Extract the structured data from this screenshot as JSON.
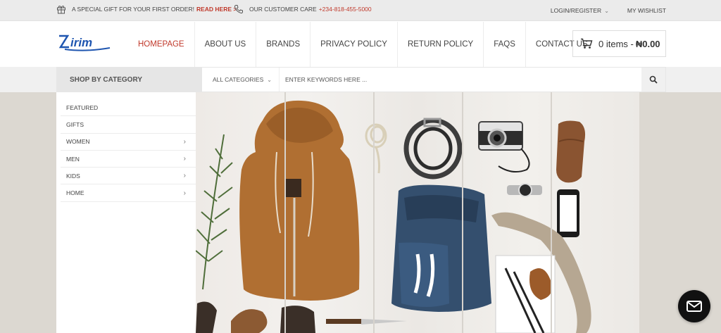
{
  "topbar": {
    "promo_text": "A special gift for your first order!",
    "promo_link": "Read Here >",
    "care_text": "OUR CUSTOMER CARE",
    "care_phone": "+234-818-455-5000",
    "login": "LOGIN/REGISTER",
    "wishlist": "MY WISHLIST"
  },
  "header": {
    "logo_text": "Zirim",
    "nav": [
      {
        "label": "HOMEPAGE",
        "active": true
      },
      {
        "label": "ABOUT US",
        "active": false
      },
      {
        "label": "BRANDS",
        "active": false
      },
      {
        "label": "PRIVACY POLICY",
        "active": false
      },
      {
        "label": "RETURN POLICY",
        "active": false
      },
      {
        "label": "FAQS",
        "active": false
      },
      {
        "label": "CONTACT US",
        "active": false
      }
    ],
    "cart_count": "0 items -",
    "cart_total": "₦0.00"
  },
  "search": {
    "shop_by_category": "SHOP BY CATEGORY",
    "all_categories": "ALL CATEGORIES",
    "placeholder": "ENTER KEYWORDS HERE ..."
  },
  "sidebar": {
    "items": [
      {
        "label": "FEATURED",
        "has_sub": false
      },
      {
        "label": "GIFTS",
        "has_sub": false
      },
      {
        "label": "WOMEN",
        "has_sub": true
      },
      {
        "label": "MEN",
        "has_sub": true
      },
      {
        "label": "KIDS",
        "has_sub": true
      },
      {
        "label": "HOME",
        "has_sub": true
      }
    ]
  },
  "colors": {
    "accent": "#c0392b",
    "logo_blue": "#1f56b0"
  },
  "icons": [
    "gift-icon",
    "phone-icon",
    "chevron-down-icon",
    "cart-icon",
    "search-icon",
    "chevron-right-icon",
    "mail-icon"
  ]
}
